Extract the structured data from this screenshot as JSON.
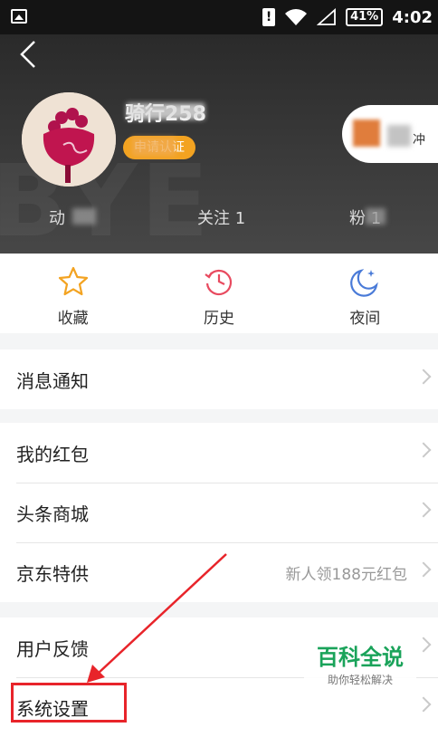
{
  "status_bar": {
    "battery": "41%",
    "time": "4:02"
  },
  "header": {
    "username": "骑行258",
    "badge": "申请认证",
    "pill_text": "冲",
    "stats": [
      {
        "text": "动"
      },
      {
        "text": "关注 1"
      },
      {
        "text": "粉 1"
      }
    ]
  },
  "quick_actions": [
    {
      "label": "收藏",
      "icon": "star-icon"
    },
    {
      "label": "历史",
      "icon": "history-clock-icon"
    },
    {
      "label": "夜间",
      "icon": "night-mode-icon"
    }
  ],
  "menu": {
    "notify": "消息通知",
    "red_packet": "我的红包",
    "mall": "头条商城",
    "jd": "京东特供",
    "jd_sub": "新人领188元红包",
    "feedback": "用户反馈",
    "settings": "系统设置"
  },
  "watermark": {
    "title": "百科全说",
    "subtitle": "助你轻松解决"
  },
  "colors": {
    "accent_orange": "#f3a321",
    "highlight_red": "#e8242a",
    "watermark_green": "#1aa35a"
  }
}
